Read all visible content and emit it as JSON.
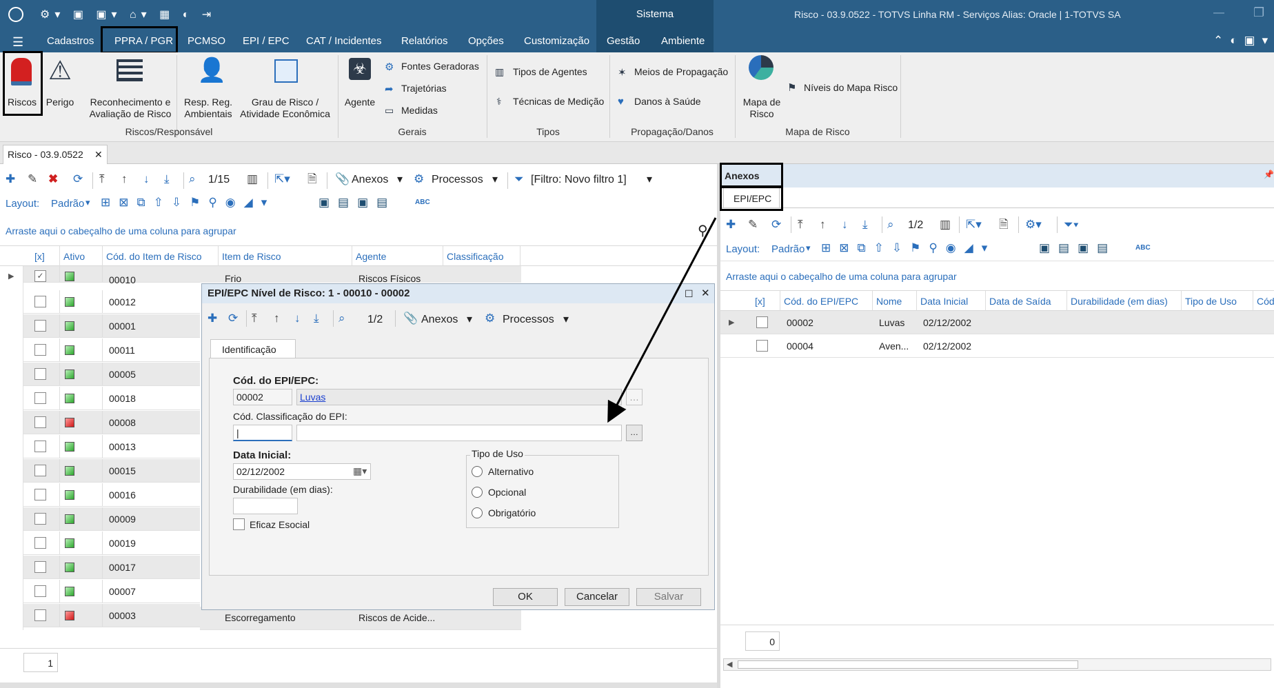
{
  "titlebar": {
    "center": "Sistema",
    "right": "Risco - 03.9.0522 - TOTVS Linha RM - Serviços  Alias: Oracle | 1-TOTVS SA"
  },
  "menu": {
    "items": [
      "Cadastros",
      "PPRA / PGR",
      "PCMSO",
      "EPI / EPC",
      "CAT / Incidentes",
      "Relatórios",
      "Opções",
      "Customização",
      "Gestão",
      "Ambiente"
    ]
  },
  "ribbon": {
    "riscos": "Riscos",
    "perigo": "Perigo",
    "reconhecimento": [
      "Reconhecimento e",
      "Avaliação de Risco"
    ],
    "resp": [
      "Resp. Reg.",
      "Ambientais"
    ],
    "grau": [
      "Grau de Risco /",
      "Atividade Econômica"
    ],
    "group1": "Riscos/Responsável",
    "agente": "Agente",
    "fontes": "Fontes Geradoras",
    "trajetorias": "Trajetórias",
    "medidas": "Medidas",
    "group2": "Gerais",
    "tipos_agentes": "Tipos de Agentes",
    "tecnicas": "Técnicas de Medição",
    "group3": "Tipos",
    "meios": "Meios de Propagação",
    "danos": "Danos à Saúde",
    "group4": "Propagação/Danos",
    "mapa": [
      "Mapa de",
      "Risco"
    ],
    "niveis": "Níveis do Mapa Risco",
    "group5": "Mapa de Risco"
  },
  "doc_tab": "Risco - 03.9.0522",
  "left_toolbar": {
    "counter": "1/15",
    "anexos": "Anexos",
    "processos": "Processos",
    "filtro": "[Filtro: Novo filtro 1]",
    "layout_label": "Layout:",
    "layout_value": "Padrão"
  },
  "group_hint": "Arraste aqui o cabeçalho de uma coluna para agrupar",
  "left_grid": {
    "headers": [
      "[x]",
      "Ativo",
      "Cód. do Item de Risco",
      "Item de Risco",
      "Agente",
      "Classificação"
    ],
    "rows": [
      {
        "code": "00010",
        "status": "green",
        "checked": true,
        "item": "Frio",
        "agente": "Riscos Físicos"
      },
      {
        "code": "00012",
        "status": "green",
        "checked": false
      },
      {
        "code": "00001",
        "status": "green",
        "checked": false
      },
      {
        "code": "00011",
        "status": "green",
        "checked": false
      },
      {
        "code": "00005",
        "status": "green",
        "checked": false
      },
      {
        "code": "00018",
        "status": "green",
        "checked": false
      },
      {
        "code": "00008",
        "status": "red",
        "checked": false
      },
      {
        "code": "00013",
        "status": "green",
        "checked": false
      },
      {
        "code": "00015",
        "status": "green",
        "checked": false
      },
      {
        "code": "00016",
        "status": "green",
        "checked": false
      },
      {
        "code": "00009",
        "status": "green",
        "checked": false
      },
      {
        "code": "00019",
        "status": "green",
        "checked": false
      },
      {
        "code": "00017",
        "status": "green",
        "checked": false
      },
      {
        "code": "00007",
        "status": "green",
        "checked": false
      },
      {
        "code": "00003",
        "status": "red",
        "checked": false,
        "item": "Escorregamento",
        "agente": "Riscos de Acide..."
      }
    ],
    "footer_count": "1"
  },
  "dialog": {
    "title": "EPI/EPC Nível de Risco: 1 - 00010 - 00002",
    "counter": "1/2",
    "anexos": "Anexos",
    "processos": "Processos",
    "tab": "Identificação",
    "cod_epi_label": "Cód. do EPI/EPC:",
    "cod_epi_value": "00002",
    "cod_epi_link": "Luvas",
    "cod_class_label": "Cód. Classificação do EPI:",
    "data_inicial_label": "Data Inicial:",
    "data_inicial_value": "02/12/2002",
    "durabilidade_label": "Durabilidade (em dias):",
    "eficaz_label": "Eficaz Esocial",
    "tipo_uso_label": "Tipo de Uso",
    "tipo_uso_options": [
      "Alternativo",
      "Opcional",
      "Obrigatório"
    ],
    "ok": "OK",
    "cancelar": "Cancelar",
    "salvar": "Salvar"
  },
  "anexos_panel": {
    "title": "Anexos",
    "tab": "EPI/EPC",
    "counter": "1/2",
    "layout_label": "Layout:",
    "layout_value": "Padrão",
    "headers": [
      "[x]",
      "Cód. do EPI/EPC",
      "Nome",
      "Data Inicial",
      "Data de Saída",
      "Durabilidade (em dias)",
      "Tipo de Uso",
      "Cód"
    ],
    "rows": [
      {
        "code": "00002",
        "nome": "Luvas",
        "data": "02/12/2002"
      },
      {
        "code": "00004",
        "nome": "Aven...",
        "data": "02/12/2002"
      }
    ],
    "footer_count": "0"
  }
}
